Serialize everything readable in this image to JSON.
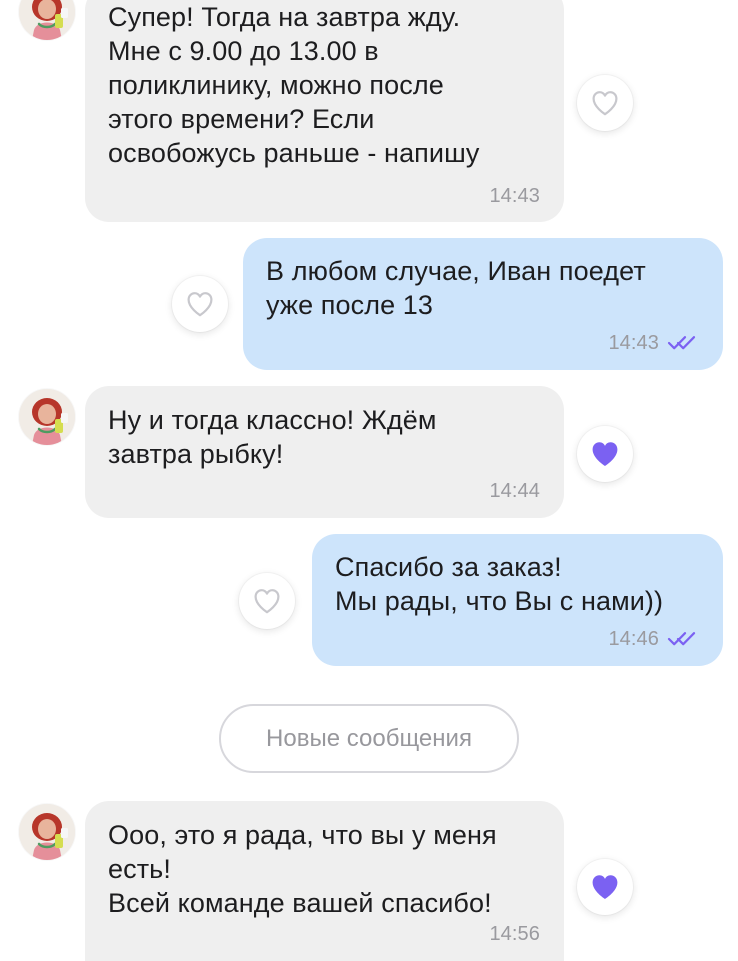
{
  "colors": {
    "incoming_bubble": "#efefef",
    "outgoing_bubble": "#cde4fb",
    "accent": "#7b61f2",
    "time_text": "#9a9a9f",
    "message_text": "#1d1d1f"
  },
  "icons": {
    "like_empty": "heart-outline-icon",
    "like_filled": "heart-filled-icon",
    "read_receipt": "double-check-icon"
  },
  "messages": [
    {
      "direction": "incoming",
      "text": "Супер! Тогда на завтра жду.\nМне с 9.00 до 13.00 в\nполиклинику, можно после\nэтого времени? Если\nосвобожусь раньше - напишу",
      "time": "14:43",
      "liked": false
    },
    {
      "direction": "outgoing",
      "text": "В любом случае, Иван поедет\nуже после 13",
      "time": "14:43",
      "liked": false,
      "read": true
    },
    {
      "direction": "incoming",
      "text": "Ну и тогда классно! Ждём\nзавтра рыбку!",
      "time": "14:44",
      "liked": true
    },
    {
      "direction": "outgoing",
      "text": "Спасибо за заказ!\nМы рады, что Вы с нами))",
      "time": "14:46",
      "liked": false,
      "read": true
    },
    {
      "direction": "incoming",
      "text": "Ооо, это я рада, что вы у меня\nесть!\nВсей команде вашей спасибо!",
      "time": "14:56",
      "liked": true
    }
  ],
  "new_messages_label": "Новые сообщения"
}
